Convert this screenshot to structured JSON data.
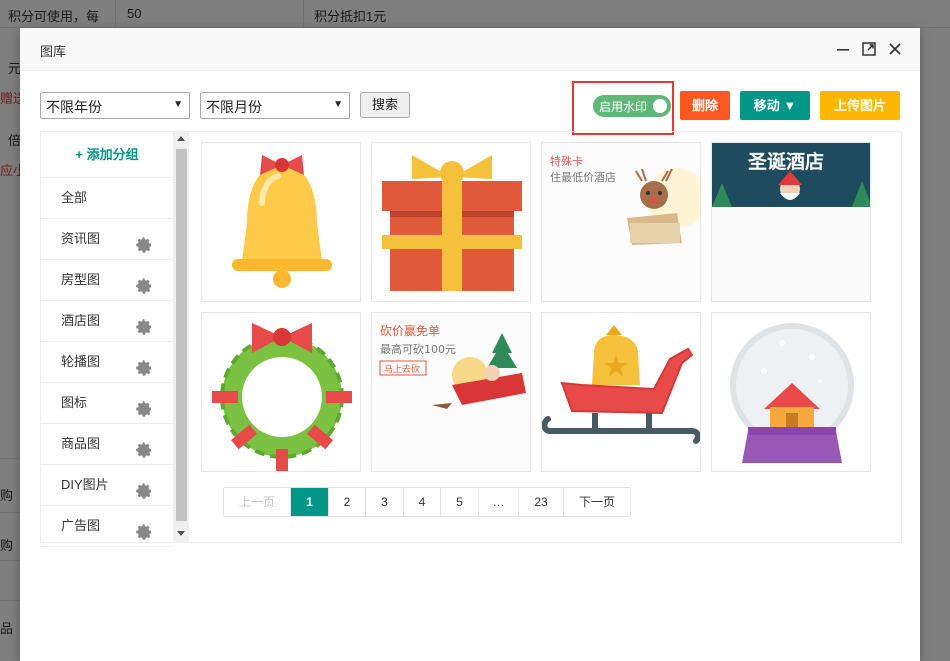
{
  "background": {
    "row1": {
      "col1": "积分可使用，每",
      "col2": "50",
      "col3": "积分抵扣1元"
    },
    "fragments": [
      "元",
      "赠送",
      "倍",
      "应小",
      "购",
      "购",
      "品"
    ]
  },
  "modal": {
    "title": "图库",
    "controls": [
      "minimize-icon",
      "maximize-icon",
      "close-icon"
    ]
  },
  "toolbar": {
    "year_select": "不限年份",
    "month_select": "不限月份",
    "search_label": "搜索",
    "watermark_label": "启用水印",
    "watermark_enabled": true,
    "delete_label": "删除",
    "move_label": "移动 ▼",
    "upload_label": "上传图片"
  },
  "colors": {
    "primary": "#009688",
    "danger": "#ff5722",
    "warn": "#ffb800",
    "toggle_on": "#5fb878",
    "highlight": "#e53935"
  },
  "sidebar": {
    "add_group": "+ 添加分组",
    "items": [
      {
        "label": "全部",
        "gear": false
      },
      {
        "label": "资讯图",
        "gear": true
      },
      {
        "label": "房型图",
        "gear": true
      },
      {
        "label": "酒店图",
        "gear": true
      },
      {
        "label": "轮播图",
        "gear": true
      },
      {
        "label": "图标",
        "gear": true
      },
      {
        "label": "商品图",
        "gear": true
      },
      {
        "label": "DIY图片",
        "gear": true
      },
      {
        "label": "广告图",
        "gear": true
      }
    ]
  },
  "gallery": {
    "images": [
      {
        "name": "bell-image"
      },
      {
        "name": "gift-box-image"
      },
      {
        "name": "special-card-image",
        "title": "特殊卡",
        "subtitle": "住最低价酒店"
      },
      {
        "name": "christmas-hotel-banner",
        "title": "圣诞酒店"
      },
      {
        "name": "wreath-image"
      },
      {
        "name": "bargain-image",
        "title": "砍价赢免单",
        "subtitle": "最高可砍100元",
        "button": "马上去砍"
      },
      {
        "name": "sleigh-image"
      },
      {
        "name": "snow-globe-image"
      }
    ]
  },
  "pagination": {
    "prev": "上一页",
    "pages": [
      "1",
      "2",
      "3",
      "4",
      "5",
      "…",
      "23"
    ],
    "current": "1",
    "next": "下一页"
  }
}
